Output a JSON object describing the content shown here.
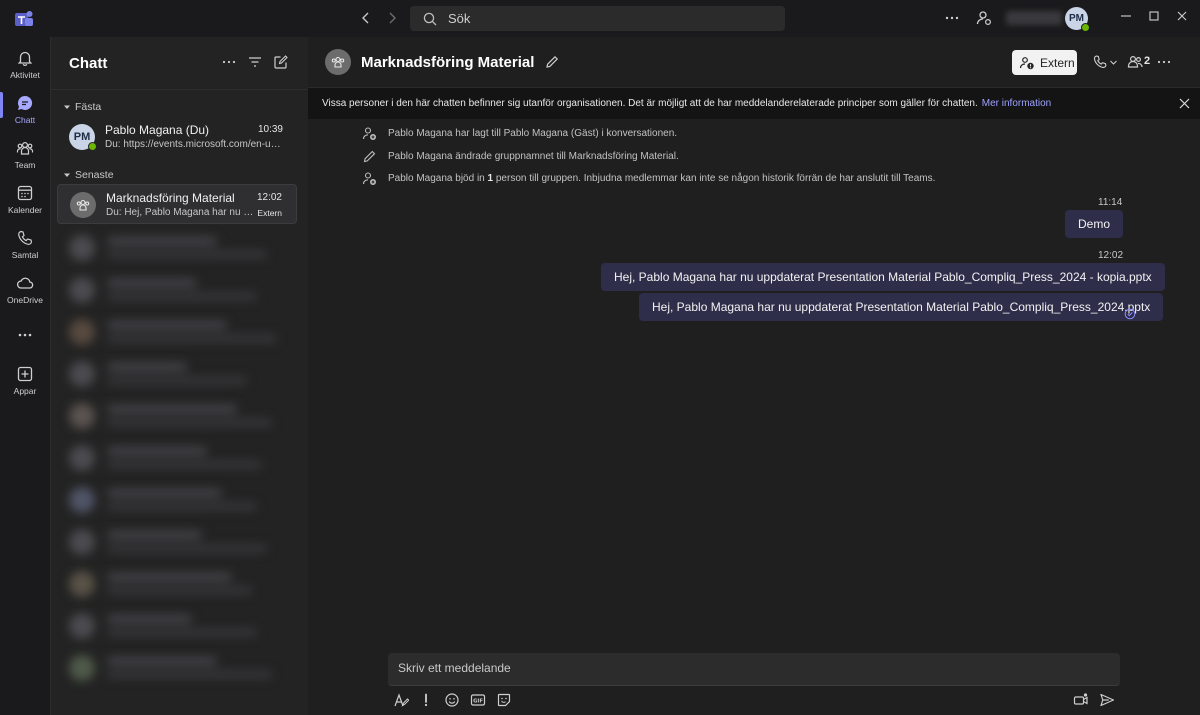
{
  "titlebar": {
    "search_placeholder": "Sök",
    "avatar_initials": "PM"
  },
  "rail": {
    "items": [
      {
        "label": "Aktivitet",
        "icon": "bell-icon"
      },
      {
        "label": "Chatt",
        "icon": "chat-icon",
        "active": true
      },
      {
        "label": "Team",
        "icon": "team-icon"
      },
      {
        "label": "Kalender",
        "icon": "calendar-icon"
      },
      {
        "label": "Samtal",
        "icon": "phone-icon"
      },
      {
        "label": "OneDrive",
        "icon": "cloud-icon"
      },
      {
        "label": "",
        "icon": "more-icon"
      },
      {
        "label": "Appar",
        "icon": "add-apps-icon"
      }
    ]
  },
  "chatlist": {
    "title": "Chatt",
    "pinned_section": "Fästa",
    "recent_section": "Senaste",
    "pinned": [
      {
        "initials": "PM",
        "name": "Pablo Magana (Du)",
        "time": "10:39",
        "preview": "Du: https://events.microsoft.com/en-us/..."
      }
    ],
    "recent": [
      {
        "name": "Marknadsföring Material",
        "time": "12:02",
        "preview": "Du: Hej, Pablo Magana har nu uppdaterat Presentation Material Pablo_Compliq_Press_2024.pptx",
        "badge": "Extern",
        "selected": true
      }
    ]
  },
  "chat": {
    "title": "Marknadsföring Material",
    "extern_label": "Extern",
    "participant_count": "2",
    "banner_text": "Vissa personer i den här chatten befinner sig utanför organisationen. Det är möjligt att de har meddelanderelaterade principer som gäller för chatten.",
    "banner_link": "Mer information",
    "system_messages": [
      {
        "icon": "person-add-icon",
        "text": "Pablo Magana har lagt till Pablo Magana (Gäst) i konversationen."
      },
      {
        "icon": "pencil-icon",
        "text": "Pablo Magana ändrade gruppnamnet till Marknadsföring Material."
      },
      {
        "icon": "person-add-icon",
        "text_before": "Pablo Magana bjöd in ",
        "count": "1",
        "text_after": " person till gruppen. Inbjudna medlemmar kan inte se någon historik förrän de har anslutit till Teams."
      }
    ],
    "messages": [
      {
        "time": "11:14",
        "text": "Demo"
      },
      {
        "time": "12:02",
        "text": "Hej, Pablo Magana har nu uppdaterat Presentation Material Pablo_Compliq_Press_2024 - kopia.pptx"
      },
      {
        "time": "",
        "text": "Hej, Pablo Magana har nu uppdaterat Presentation Material Pablo_Compliq_Press_2024.pptx"
      }
    ],
    "composer_placeholder": "Skriv ett meddelande"
  },
  "colors": {
    "accent": "#7f85f5",
    "bubble": "#2e2e4a",
    "presence_available": "#6bb700"
  }
}
